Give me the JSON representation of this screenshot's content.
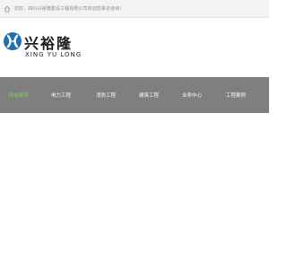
{
  "topbar": {
    "icon": "home-icon",
    "welcome_text": "您好，四川兴裕隆建设工程有限公司欢迎您来访咨询!"
  },
  "logo": {
    "emblem": "xyl-emblem-icon",
    "name_cn": "兴裕隆",
    "name_en": "XING YU LONG"
  },
  "nav": {
    "items": [
      {
        "label": "网站首页",
        "active": true
      },
      {
        "label": "电力工程",
        "active": false
      },
      {
        "label": "消防工程",
        "active": false
      },
      {
        "label": "建筑工程",
        "active": false
      },
      {
        "label": "业务中心",
        "active": false
      },
      {
        "label": "工程案例",
        "active": false
      }
    ]
  },
  "colors": {
    "nav_bg": "#7f7f7f",
    "nav_active": "#7ed957",
    "brand_blue": "#1f6fb6",
    "topbar_bg": "#f3f3f3"
  }
}
